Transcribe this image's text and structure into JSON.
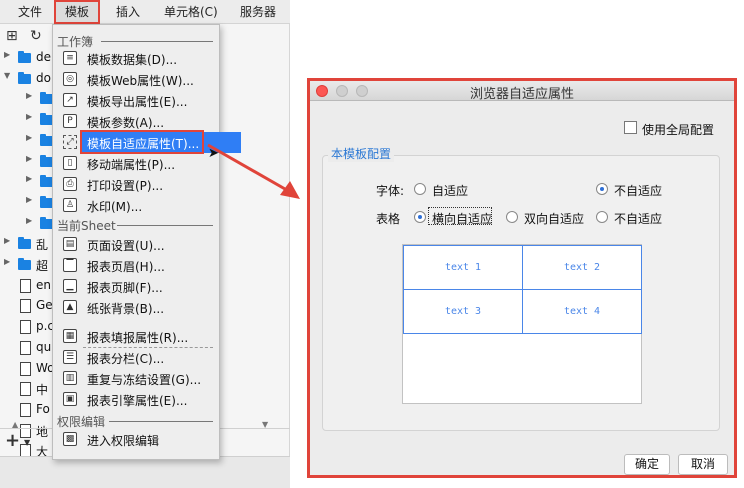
{
  "menubar": {
    "items": [
      "文件",
      "模板",
      "插入",
      "单元格(C)",
      "服务器"
    ]
  },
  "tree": {
    "rows": [
      {
        "label": "de",
        "type": "folder",
        "arrow": "right"
      },
      {
        "label": "do",
        "type": "folder",
        "arrow": "down"
      },
      {
        "label": "",
        "type": "folder",
        "arrow": "right"
      },
      {
        "label": "",
        "type": "folder",
        "arrow": "right"
      },
      {
        "label": "",
        "type": "folder",
        "arrow": "right"
      },
      {
        "label": "",
        "type": "folder",
        "arrow": "right"
      },
      {
        "label": "",
        "type": "folder",
        "arrow": "right"
      },
      {
        "label": "",
        "type": "folder",
        "arrow": "right"
      },
      {
        "label": "",
        "type": "folder",
        "arrow": "right"
      },
      {
        "label": "乱",
        "type": "folder",
        "arrow": "right"
      },
      {
        "label": "超",
        "type": "folder",
        "arrow": "right"
      },
      {
        "label": "en",
        "type": "file"
      },
      {
        "label": "Ge",
        "type": "file"
      },
      {
        "label": "p.c",
        "type": "file"
      },
      {
        "label": "qu",
        "type": "file"
      },
      {
        "label": "Wo",
        "type": "file"
      },
      {
        "label": "中",
        "type": "file"
      },
      {
        "label": "Fo",
        "type": "file"
      },
      {
        "label": "地",
        "type": "file"
      },
      {
        "label": "大",
        "type": "file"
      }
    ]
  },
  "dropdown": {
    "section_workbook": "工作簿",
    "section_sheet": "当前Sheet",
    "section_permission": "权限编辑",
    "items": [
      {
        "label": "模板数据集(D)...",
        "icon": "database-icon",
        "glyph": "≡"
      },
      {
        "label": "模板Web属性(W)...",
        "icon": "globe-icon",
        "glyph": "◎"
      },
      {
        "label": "模板导出属性(E)...",
        "icon": "export-icon",
        "glyph": "↗"
      },
      {
        "label": "模板参数(A)...",
        "icon": "parameter-icon",
        "glyph": "P"
      },
      {
        "label": "模板自适应属性(T)...",
        "icon": "adaptive-icon",
        "glyph": "⤢"
      },
      {
        "label": "移动端属性(P)...",
        "icon": "mobile-icon",
        "glyph": "▯"
      },
      {
        "label": "打印设置(P)...",
        "icon": "printer-icon",
        "glyph": "⎙"
      },
      {
        "label": "水印(M)...",
        "icon": "stamp-icon",
        "glyph": "♙"
      },
      {
        "label": "页面设置(U)...",
        "icon": "page-setup-icon",
        "glyph": "▤"
      },
      {
        "label": "报表页眉(H)...",
        "icon": "header-icon",
        "glyph": "▔"
      },
      {
        "label": "报表页脚(F)...",
        "icon": "footer-icon",
        "glyph": "▁"
      },
      {
        "label": "纸张背景(B)...",
        "icon": "image-icon",
        "glyph": "▲"
      },
      {
        "label": "报表填报属性(R)...",
        "icon": "form-icon",
        "glyph": "▦"
      },
      {
        "label": "报表分栏(C)...",
        "icon": "columns-icon",
        "glyph": "☰"
      },
      {
        "label": "重复与冻结设置(G)...",
        "icon": "freeze-icon",
        "glyph": "▥"
      },
      {
        "label": "报表引擎属性(E)...",
        "icon": "engine-icon",
        "glyph": "▣"
      },
      {
        "label": "进入权限编辑",
        "icon": "permission-icon",
        "glyph": "▩"
      }
    ]
  },
  "dialog": {
    "title": "浏览器自适应属性",
    "global_config_label": "使用全局配置",
    "group_title": "本模板配置",
    "font_label": "字体:",
    "font_options": [
      "自适应",
      "不自适应"
    ],
    "table_label": "表格",
    "table_options": [
      "横向自适应",
      "双向自适应",
      "不自适应"
    ],
    "preview_cells": [
      "text 1",
      "text 2",
      "text 3",
      "text 4"
    ],
    "ok_label": "确定",
    "cancel_label": "取消"
  },
  "colors": {
    "highlight_red": "#e0443a",
    "selection_blue": "#2f7ef5",
    "group_title_blue": "#2b78d4",
    "cell_blue": "#4a86e8"
  }
}
